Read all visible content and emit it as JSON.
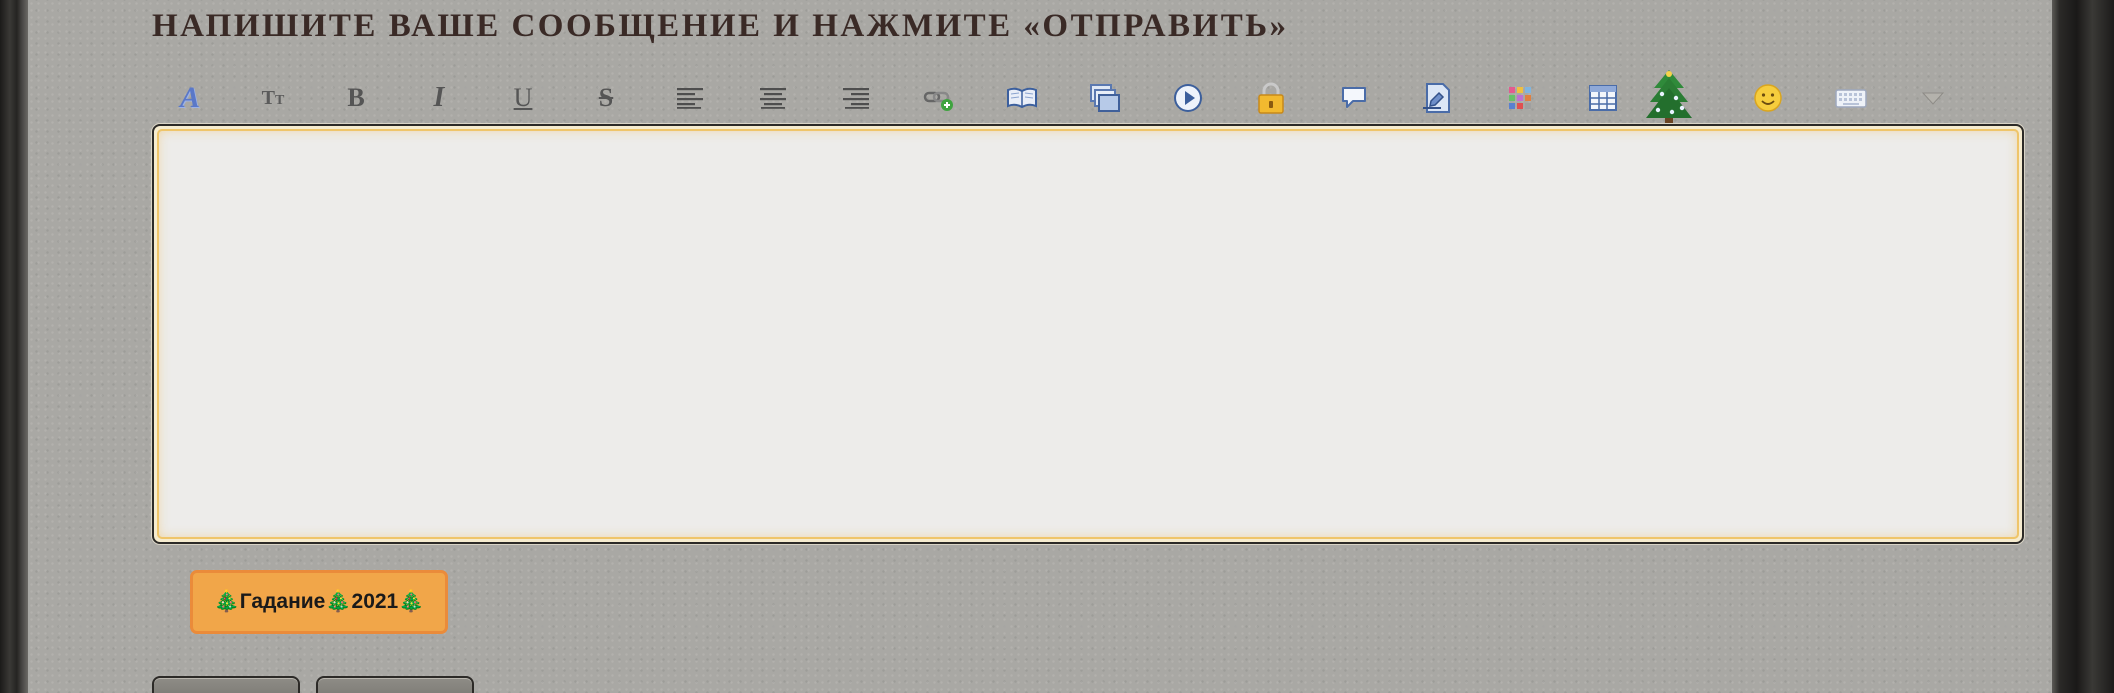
{
  "form": {
    "title": "НАПИШИТЕ ВАШЕ СООБЩЕНИЕ И НАЖМИТЕ «ОТПРАВИТЬ»",
    "message_value": ""
  },
  "toolbar": {
    "tools": [
      {
        "name": "font-color-icon",
        "glyph": "A"
      },
      {
        "name": "font-size-icon",
        "glyph": "TT"
      },
      {
        "name": "bold-icon",
        "glyph": "B"
      },
      {
        "name": "italic-icon",
        "glyph": "I"
      },
      {
        "name": "underline-icon",
        "glyph": "U"
      },
      {
        "name": "strikethrough-icon",
        "glyph": "S"
      },
      {
        "name": "align-left-icon"
      },
      {
        "name": "align-center-icon"
      },
      {
        "name": "align-right-icon"
      },
      {
        "name": "link-icon"
      },
      {
        "name": "book-icon"
      },
      {
        "name": "image-gallery-icon"
      },
      {
        "name": "video-play-icon"
      },
      {
        "name": "lock-icon"
      },
      {
        "name": "speech-bubble-icon"
      },
      {
        "name": "document-edit-icon"
      },
      {
        "name": "color-palette-icon"
      },
      {
        "name": "table-icon"
      },
      {
        "name": "christmas-tree-icon"
      },
      {
        "name": "smiley-icon"
      },
      {
        "name": "keyboard-icon"
      },
      {
        "name": "more-dropdown-icon"
      }
    ]
  },
  "tag_button": {
    "label": "🎄Гадание🎄2021🎄"
  },
  "colors": {
    "panel": "#a9a8a4",
    "title": "#3a2a26",
    "editor_glow": "#efc56a",
    "tag_button": "#f1a649",
    "tag_border": "#ea8b3a"
  }
}
